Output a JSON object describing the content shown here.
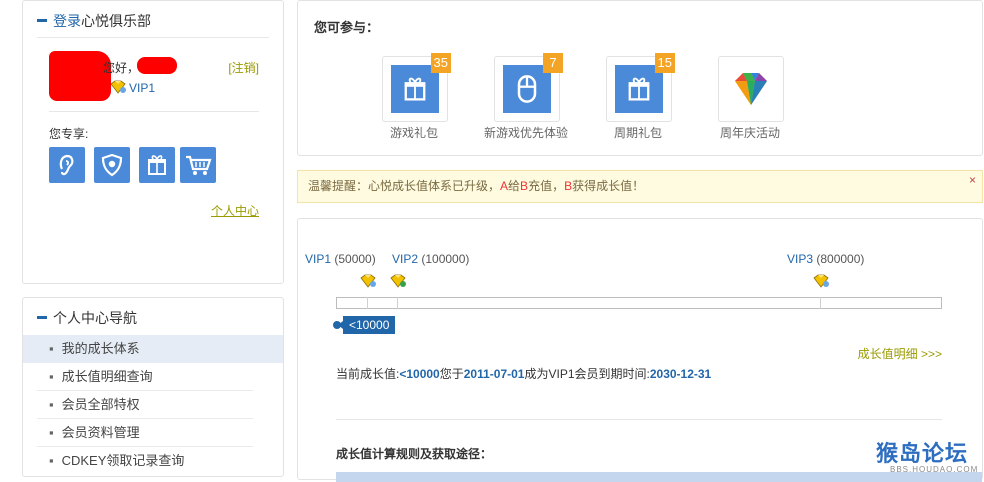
{
  "login_panel": {
    "title_login": "登录",
    "title_rest": "心悦俱乐部",
    "greeting": "您好，",
    "logout": "[注销]",
    "vip_level": "VIP1",
    "exclusive_label": "您专享:",
    "services": [
      "ear-service-icon",
      "shield-icon",
      "gift-icon",
      "cart-icon"
    ],
    "center_link": "个人中心"
  },
  "nav_panel": {
    "title": "个人中心导航",
    "items": [
      {
        "label": "我的成长体系"
      },
      {
        "label": "成长值明细查询"
      },
      {
        "label": "会员全部特权"
      },
      {
        "label": "会员资料管理"
      },
      {
        "label": "CDKEY领取记录查询"
      }
    ]
  },
  "join_panel": {
    "title": "您可参与：",
    "activities": [
      {
        "label": "游戏礼包",
        "badge": "35",
        "icon": "gift-icon"
      },
      {
        "label": "新游戏优先体验",
        "badge": "7",
        "icon": "mouse-icon"
      },
      {
        "label": "周期礼包",
        "badge": "15",
        "icon": "gift-icon"
      },
      {
        "label": "周年庆活动",
        "badge": "",
        "icon": "diamond-icon"
      }
    ]
  },
  "notice": {
    "prefix": "温馨提醒：心悦成长值体系已升级，",
    "a": "A",
    "give": "给",
    "b1": "B",
    "recharge": "充值，",
    "b2": "B",
    "gain": "获得成长值！",
    "close": "×"
  },
  "growth": {
    "levels": [
      {
        "name": "VIP1",
        "value": "(50000)"
      },
      {
        "name": "VIP2",
        "value": "(100000)"
      },
      {
        "name": "VIP3",
        "value": "(800000)"
      }
    ],
    "current_label": "<10000",
    "detail_link": "成长值明细 >>>",
    "status_prefix": "当前成长值:",
    "status_value": "<10000",
    "status_mid1": "您于",
    "status_date": "2011-07-01",
    "status_mid2": "成为VIP1会员到期时间:",
    "status_expire": "2030-12-31",
    "rules_title": "成长值计算规则及获取途径："
  },
  "watermark": {
    "cn": "猴岛论坛",
    "en": "BBS.HOUDAO.COM"
  },
  "colors": {
    "accent": "#2266aa",
    "icon_bg": "#4a8ad8",
    "badge": "#f4a424",
    "redaction": "#ff0000",
    "link_olive": "#9a9a00"
  }
}
